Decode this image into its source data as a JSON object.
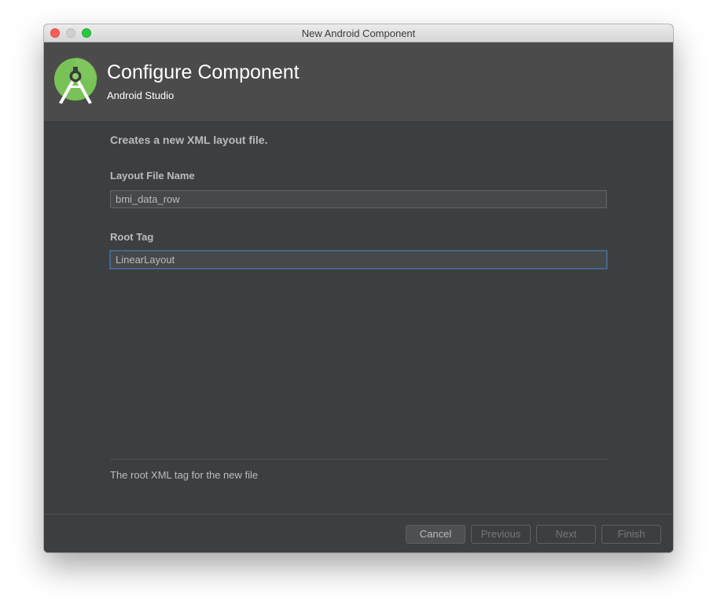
{
  "window": {
    "title": "New Android Component"
  },
  "header": {
    "title": "Configure Component",
    "subtitle": "Android Studio",
    "logo_icon": "android-studio-logo-icon"
  },
  "form": {
    "description": "Creates a new XML layout file.",
    "layout_file_name": {
      "label": "Layout File Name",
      "value": "bmi_data_row"
    },
    "root_tag": {
      "label": "Root Tag",
      "value": "LinearLayout"
    },
    "hint": "The root XML tag for the new file"
  },
  "buttons": {
    "cancel": "Cancel",
    "previous": "Previous",
    "next": "Next",
    "finish": "Finish"
  },
  "colors": {
    "accent": "#466d94",
    "logo_green": "#78c257",
    "background": "#3c3f41",
    "header": "#4b4b4b"
  }
}
